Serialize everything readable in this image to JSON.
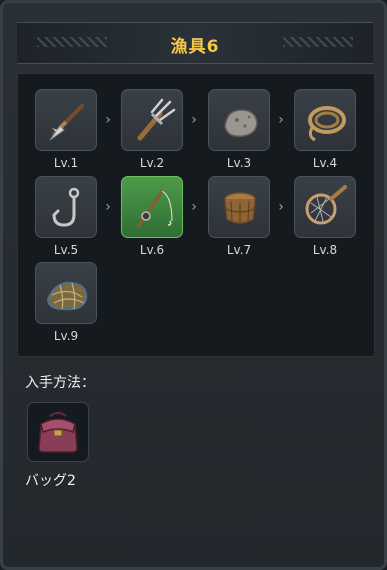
{
  "title": "漁具6",
  "items": [
    {
      "level": "Lv.1",
      "icon": "harpoon-icon"
    },
    {
      "level": "Lv.2",
      "icon": "trident-icon"
    },
    {
      "level": "Lv.3",
      "icon": "stone-icon"
    },
    {
      "level": "Lv.4",
      "icon": "rope-icon"
    },
    {
      "level": "Lv.5",
      "icon": "hook-icon"
    },
    {
      "level": "Lv.6",
      "icon": "fishing-rod-icon",
      "active": true
    },
    {
      "level": "Lv.7",
      "icon": "fish-trap-icon"
    },
    {
      "level": "Lv.8",
      "icon": "landing-net-icon"
    },
    {
      "level": "Lv.9",
      "icon": "fishing-net-icon"
    }
  ],
  "acquire": {
    "label": "入手方法：",
    "source_name": "バッグ2",
    "source_icon": "bag-icon"
  },
  "colors": {
    "title": "#f7c844",
    "active_slot": "#4f9a4a"
  }
}
